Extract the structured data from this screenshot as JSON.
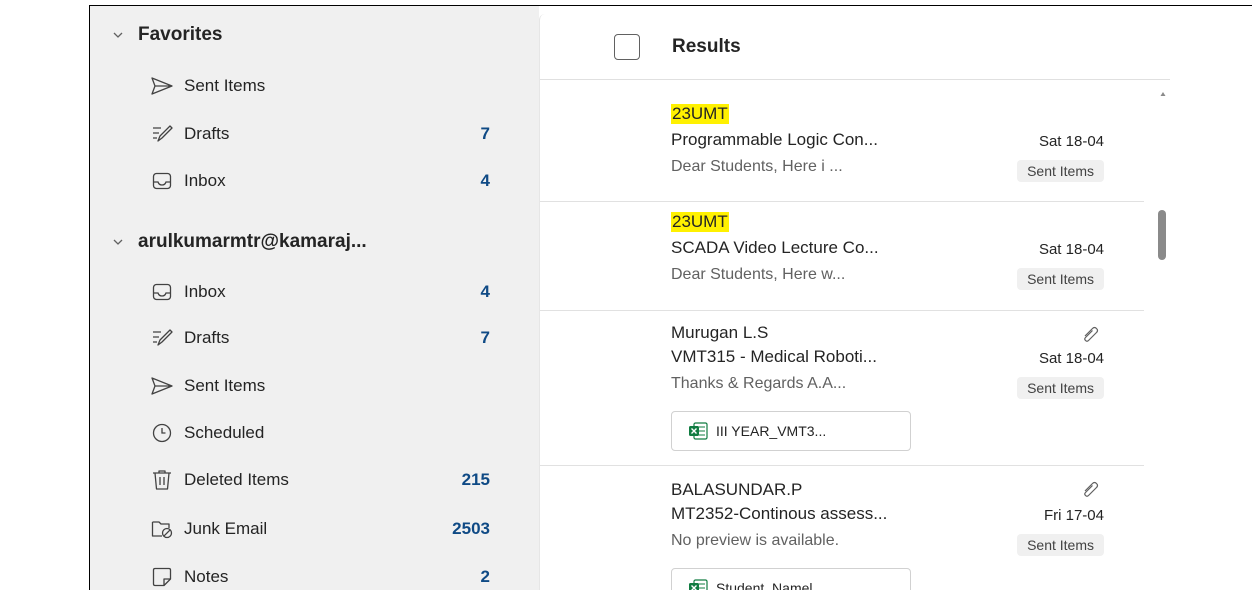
{
  "favorites": {
    "header": "Favorites",
    "items": [
      {
        "label": "Sent Items",
        "count": "",
        "icon": "send-icon"
      },
      {
        "label": "Drafts",
        "count": "7",
        "icon": "drafts-icon"
      },
      {
        "label": "Inbox",
        "count": "4",
        "icon": "inbox-icon"
      }
    ]
  },
  "account": {
    "header": "arulkumarmtr@kamaraj...",
    "items": [
      {
        "label": "Inbox",
        "count": "4",
        "icon": "inbox-icon"
      },
      {
        "label": "Drafts",
        "count": "7",
        "icon": "drafts-icon"
      },
      {
        "label": "Sent Items",
        "count": "",
        "icon": "send-icon"
      },
      {
        "label": "Scheduled",
        "count": "",
        "icon": "clock-icon"
      },
      {
        "label": "Deleted Items",
        "count": "215",
        "icon": "trash-icon"
      },
      {
        "label": "Junk Email",
        "count": "2503",
        "icon": "junk-folder-icon"
      },
      {
        "label": "Notes",
        "count": "2",
        "icon": "notes-icon"
      }
    ]
  },
  "list": {
    "title": "Results",
    "messages": [
      {
        "sender": "23UMT",
        "sender_highlight": true,
        "subject": "Programmable Logic Con...",
        "date": "Sat 18-04",
        "preview": "Dear Students, Here i ...",
        "folder": "Sent Items",
        "has_attachment": false,
        "attachment_name": ""
      },
      {
        "sender": "23UMT",
        "sender_highlight": true,
        "subject": "SCADA Video Lecture Co...",
        "date": "Sat 18-04",
        "preview": "Dear Students, Here w...",
        "folder": "Sent Items",
        "has_attachment": false,
        "attachment_name": ""
      },
      {
        "sender": "Murugan L.S",
        "sender_highlight": false,
        "subject": "VMT315 - Medical Roboti...",
        "date": "Sat 18-04",
        "preview": "Thanks & Regards A.A...",
        "folder": "Sent Items",
        "has_attachment": true,
        "attachment_name": "III YEAR_VMT3..."
      },
      {
        "sender": "BALASUNDAR.P",
        "sender_highlight": false,
        "subject": "MT2352-Continous assess...",
        "date": "Fri 17-04",
        "preview": "No preview is available.",
        "folder": "Sent Items",
        "has_attachment": true,
        "attachment_name": "Student_Namel..."
      }
    ]
  },
  "colors": {
    "sidebar_bg": "#f0f0f0",
    "count_text": "#0f4a85",
    "highlight": "#fff100",
    "excel_green": "#107c41"
  }
}
